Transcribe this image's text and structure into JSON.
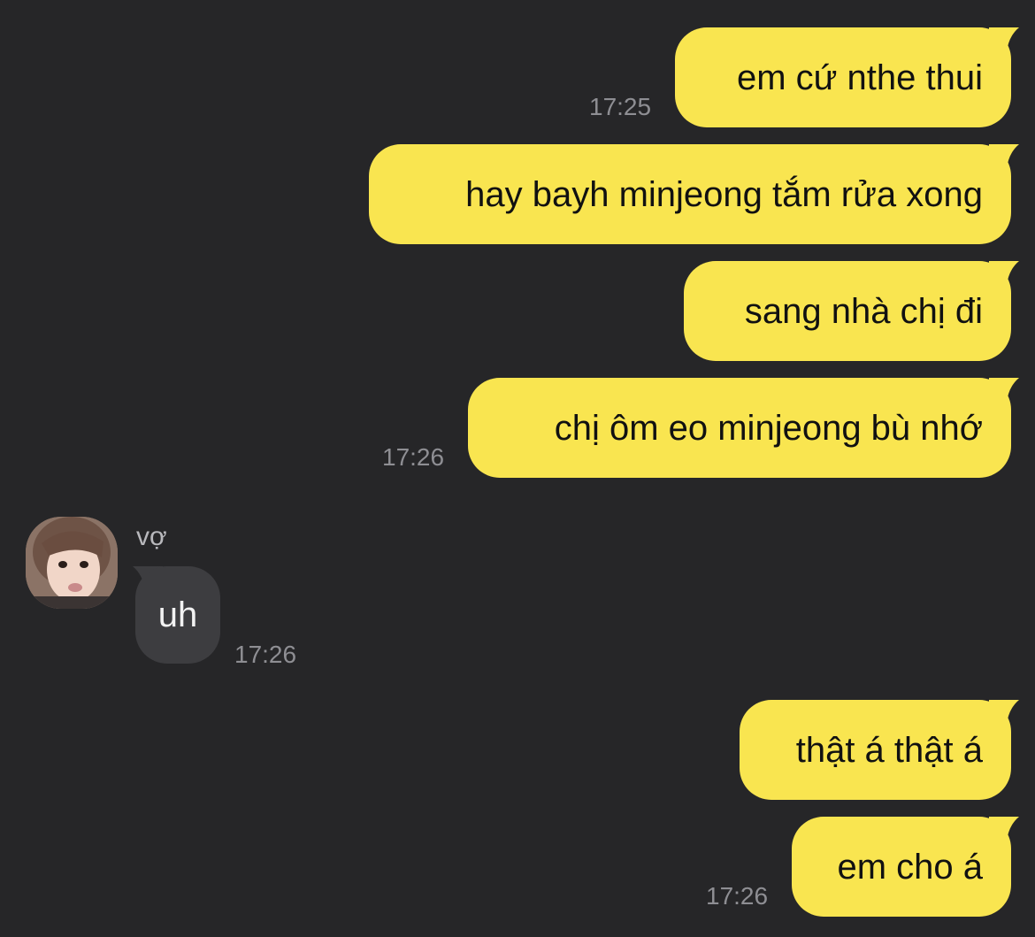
{
  "colors": {
    "background": "#262628",
    "outgoing_bubble": "#f9e550",
    "incoming_bubble": "#3d3d40",
    "timestamp": "#8e8e93"
  },
  "messages": [
    {
      "direction": "outgoing",
      "text": "em cứ nthe thui",
      "time": "17:25"
    },
    {
      "direction": "outgoing",
      "text": "hay bayh minjeong tắm rửa xong",
      "time": ""
    },
    {
      "direction": "outgoing",
      "text": "sang nhà chị đi",
      "time": ""
    },
    {
      "direction": "outgoing",
      "text": "chị ôm eo minjeong bù nhớ",
      "time": "17:26"
    },
    {
      "direction": "incoming",
      "sender": "vợ",
      "avatar_icon": "profile-photo-icon",
      "text": "uh",
      "time": "17:26"
    },
    {
      "direction": "outgoing",
      "text": "thật á thật á",
      "time": ""
    },
    {
      "direction": "outgoing",
      "text": "em cho á",
      "time": "17:26"
    }
  ]
}
